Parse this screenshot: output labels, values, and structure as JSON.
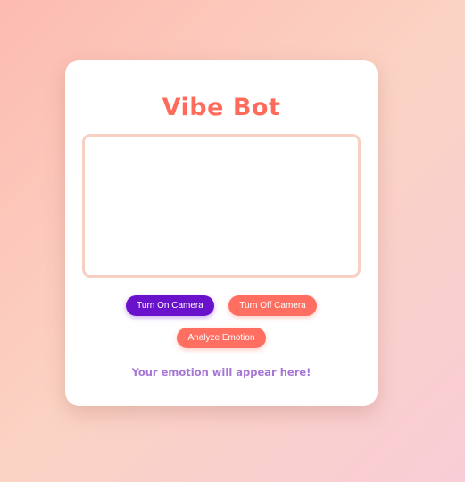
{
  "app": {
    "title": "Vibe Bot"
  },
  "camera": {
    "turn_on_label": "Turn On Camera",
    "turn_off_label": "Turn Off Camera"
  },
  "actions": {
    "analyze_label": "Analyze Emotion"
  },
  "result": {
    "text": "Your emotion will appear here!"
  },
  "colors": {
    "title": "#ff6b5b",
    "primary_button": "#6a11cb",
    "secondary_button": "#ff6f61",
    "result_text": "#a675d6",
    "video_border": "#f7cfc3"
  }
}
